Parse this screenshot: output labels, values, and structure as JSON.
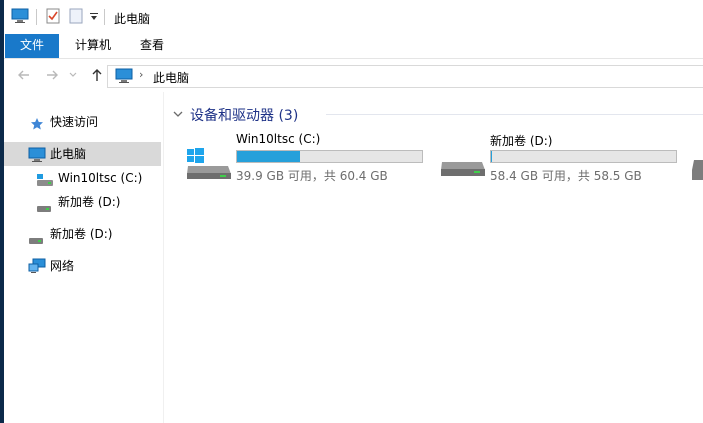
{
  "window": {
    "title": "此电脑"
  },
  "ribbon": {
    "tabs": [
      "文件",
      "计算机",
      "查看"
    ]
  },
  "address": {
    "path": "此电脑"
  },
  "sidebar": {
    "items": [
      {
        "label": "快速访问",
        "icon": "star-icon"
      },
      {
        "label": "此电脑",
        "icon": "computer-icon",
        "selected": true
      },
      {
        "label": "Win10ltsc (C:)",
        "icon": "system-drive-icon"
      },
      {
        "label": "新加卷 (D:)",
        "icon": "drive-icon"
      },
      {
        "label": "新加卷 (D:)",
        "icon": "drive-icon"
      },
      {
        "label": "网络",
        "icon": "network-icon"
      }
    ]
  },
  "main": {
    "group_title": "设备和驱动器 (3)",
    "drives": [
      {
        "name": "Win10ltsc (C:)",
        "space": "39.9 GB 可用，共 60.4 GB",
        "used_fraction": 0.34,
        "icon": "windows-drive-icon"
      },
      {
        "name": "新加卷 (D:)",
        "space": "58.4 GB 可用，共 58.5 GB",
        "used_fraction": 0.002,
        "icon": "drive-icon"
      }
    ]
  },
  "colors": {
    "accent": "#1979ca",
    "bar_fill": "#26a0da",
    "selection": "#d9d9d9",
    "group_title": "#1e3287"
  }
}
